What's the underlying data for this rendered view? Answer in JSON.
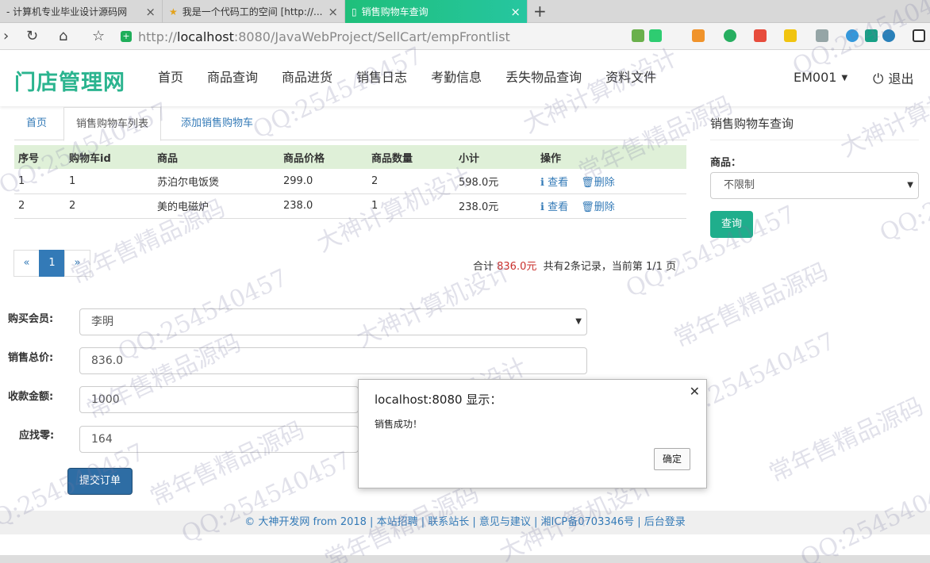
{
  "browser": {
    "tabs": [
      {
        "label": "- 计算机专业毕业设计源码网"
      },
      {
        "label": "我是一个代码工的空间 [http://..."
      },
      {
        "label": "销售购物车查询"
      }
    ],
    "url_prefix": "http://",
    "url_host": "localhost",
    "url_rest": ":8080/JavaWebProject/SellCart/empFrontlist"
  },
  "header": {
    "logo": "门店管理网",
    "nav": [
      "首页",
      "商品查询",
      "商品进货",
      "销售日志",
      "考勤信息",
      "丢失物品查询",
      "资料文件"
    ],
    "user": "EM001",
    "logout": "退出"
  },
  "content_tabs": [
    "首页",
    "销售购物车列表",
    "添加销售购物车"
  ],
  "table": {
    "headers": [
      "序号",
      "购物车id",
      "商品",
      "商品价格",
      "商品数量",
      "小计",
      "操作"
    ],
    "rows": [
      {
        "no": "1",
        "id": "1",
        "product": "苏泊尔电饭煲",
        "price": "299.0",
        "qty": "2",
        "subtotal": "598.0元"
      },
      {
        "no": "2",
        "id": "2",
        "product": "美的电磁炉",
        "price": "238.0",
        "qty": "1",
        "subtotal": "238.0元"
      }
    ],
    "view_label": "查看",
    "delete_label": "删除"
  },
  "pagination": {
    "prev": "«",
    "current": "1",
    "next": "»"
  },
  "summary": {
    "prefix": "合计 ",
    "amount": "836.0元",
    "suffix": "  共有2条记录，当前第 1/1 页"
  },
  "form": {
    "member_label": "购买会员:",
    "member_value": "李明",
    "total_label": "销售总价:",
    "total_value": "836.0",
    "paid_label": "收款金额:",
    "paid_value": "1000",
    "change_label": "应找零:",
    "change_value": "164",
    "submit": "提交订单"
  },
  "side": {
    "title": "销售购物车查询",
    "product_label": "商品：",
    "product_select": "不限制",
    "query": "查询"
  },
  "footer": "© 大神开发网 from 2018 | 本站招聘 | 联系站长 | 意见与建议 | 湘ICP备0703346号 | 后台登录",
  "dialog": {
    "title": "localhost:8080 显示：",
    "message": "销售成功！",
    "ok": "确定"
  },
  "watermarks": [
    "QQ:254540457",
    "大神计算机设计",
    "常年售精品源码"
  ]
}
